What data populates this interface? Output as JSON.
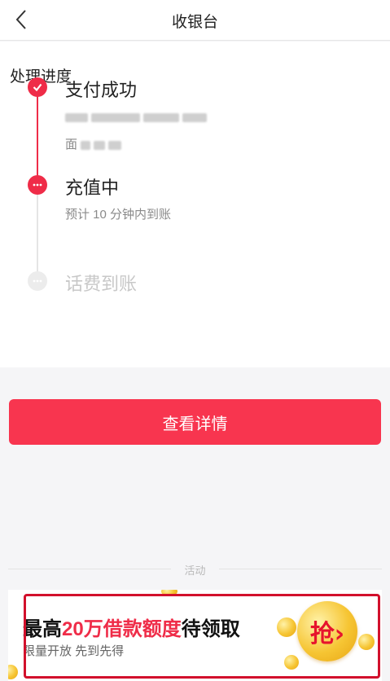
{
  "nav": {
    "title": "收银台"
  },
  "progress": {
    "section_title": "处理进度",
    "steps": [
      {
        "label": "支付成功",
        "sub_line2_prefix": "面"
      },
      {
        "label": "充值中",
        "sub": "预计 10 分钟内到账"
      },
      {
        "label": "话费到账"
      }
    ]
  },
  "actions": {
    "details_label": "查看详情"
  },
  "activity": {
    "divider_label": "活动",
    "promo": {
      "headline_pre": "最高",
      "headline_highlight": "20万借款额度",
      "headline_post": "待领取",
      "subline": "限量开放 先到先得",
      "cta_glyph": "抢›"
    }
  },
  "colors": {
    "accent": "#ef2c48",
    "button": "#f8354f",
    "frame": "#d2102c",
    "coin": "#f6c533"
  }
}
